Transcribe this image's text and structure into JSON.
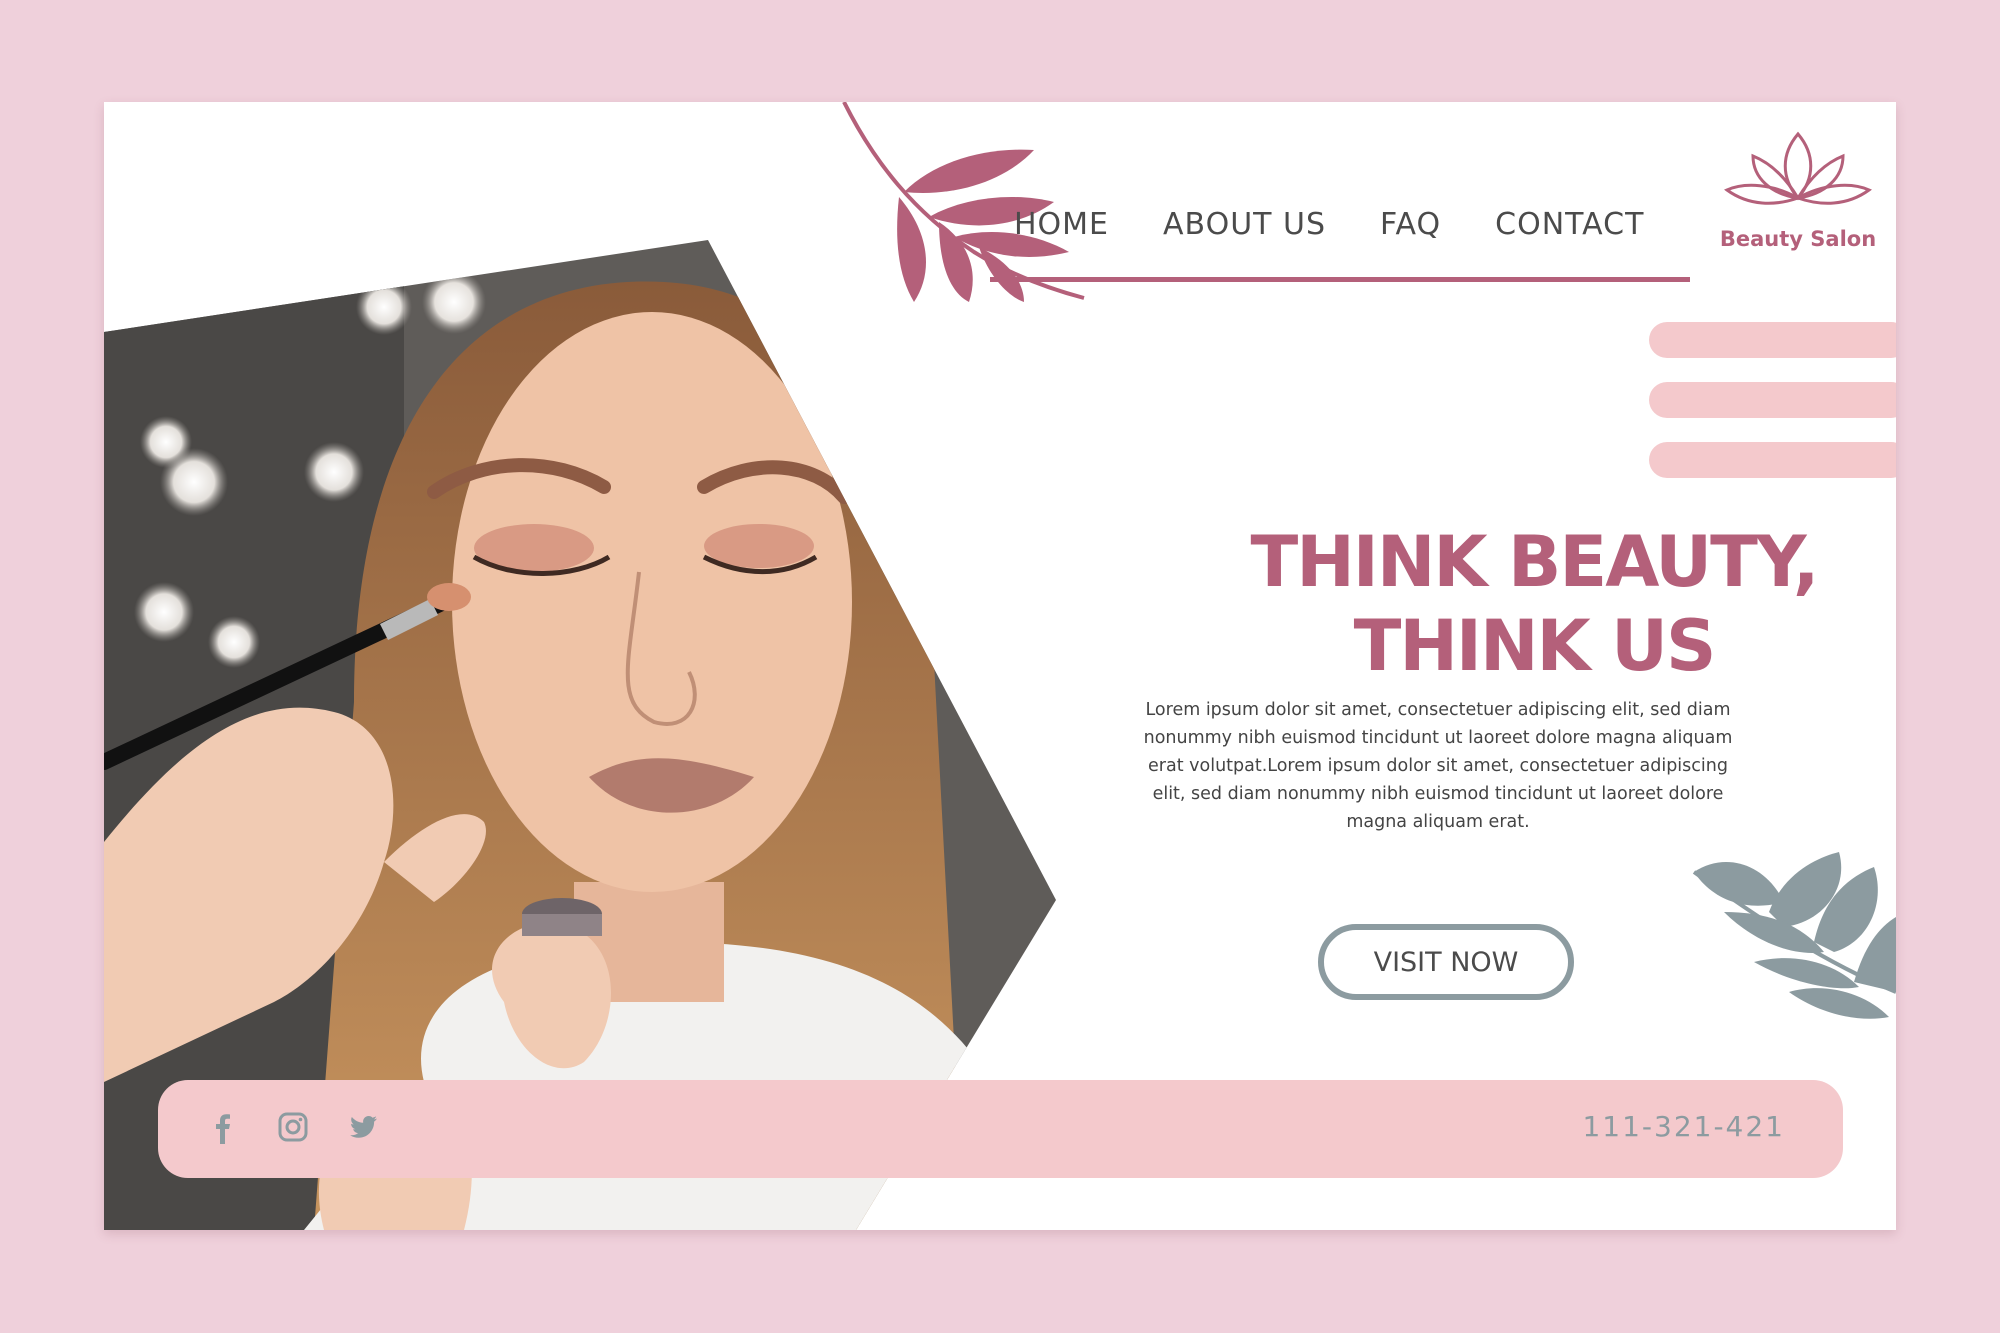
{
  "brand": {
    "name": "Beauty Salon",
    "logo_icon": "lotus-icon",
    "color": "#b4607a"
  },
  "nav": {
    "items": [
      {
        "label": "HOME"
      },
      {
        "label": "ABOUT US"
      },
      {
        "label": "FAQ"
      },
      {
        "label": "CONTACT"
      }
    ]
  },
  "hero": {
    "headline_line1": "THINK BEAUTY,",
    "headline_line2": "THINK US",
    "body": "Lorem ipsum dolor sit amet, consectetuer adipiscing elit, sed diam nonummy nibh euismod tincidunt ut laoreet dolore magna aliquam erat volutpat.Lorem ipsum dolor sit amet, consectetuer adipiscing elit, sed diam nonummy nibh euismod tincidunt ut laoreet dolore magna aliquam erat.",
    "cta_label": "VISIT NOW"
  },
  "footer": {
    "social": [
      {
        "icon": "facebook-icon"
      },
      {
        "icon": "instagram-icon"
      },
      {
        "icon": "twitter-icon"
      }
    ],
    "phone": "111-321-421"
  },
  "colors": {
    "background": "#efd0db",
    "accent": "#b4607a",
    "pink_light": "#f4c9cc",
    "grey": "#8c9ba0"
  }
}
